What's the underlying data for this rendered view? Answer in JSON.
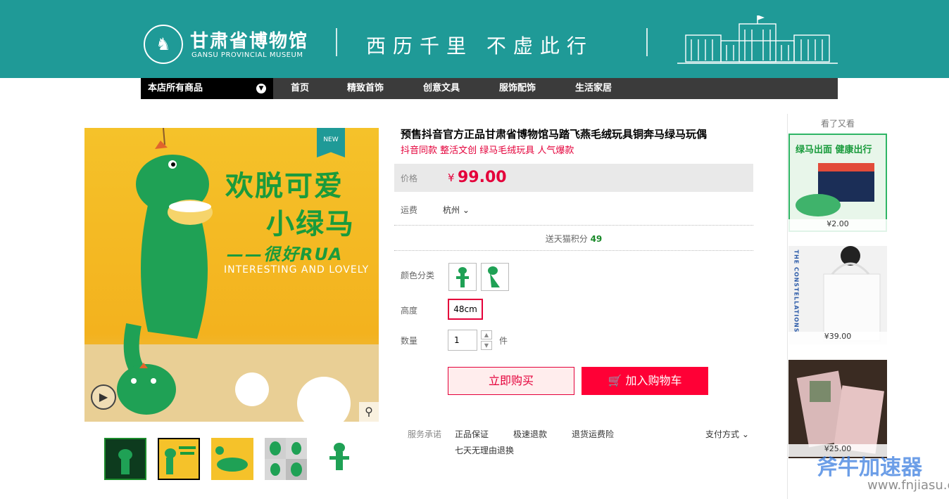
{
  "header": {
    "logo_cn": "甘肃省博物馆",
    "logo_en": "GANSU PROVINCIAL MUSEUM",
    "slogan": "西历千里  不虚此行",
    "colors": {
      "banner": "#1f9a97",
      "nav": "#3b3b3b"
    }
  },
  "nav": {
    "all_products": "本店所有商品",
    "items": [
      "首页",
      "精致首饰",
      "创意文具",
      "服饰配饰",
      "生活家居"
    ]
  },
  "gallery": {
    "badge": "NEW",
    "promo_line1": "欢脱可爱",
    "promo_line2": "小绿马",
    "promo_line3": "——很好RUA",
    "promo_line4": "INTERESTING AND LOVELY",
    "thumb_count": 5
  },
  "product": {
    "title": "预售抖音官方正品甘肃省博物馆马踏飞燕毛绒玩具铜奔马绿马玩偶",
    "subtitle": "抖音同款 整活文创 绿马毛绒玩具 人气爆款",
    "price_label": "价格",
    "price_symbol": "¥",
    "price": "99.00",
    "shipping_label": "运费",
    "shipping_value": "杭州",
    "points_text": "送天猫积分",
    "points_value": "49",
    "color_label": "颜色分类",
    "height_label": "高度",
    "height_option": "48cm",
    "quantity_label": "数量",
    "quantity": "1",
    "unit": "件",
    "buy_now": "立即购买",
    "add_cart": "加入购物车"
  },
  "service": {
    "label": "服务承诺",
    "items": [
      "正品保证",
      "极速退款",
      "退货运费险"
    ],
    "extra": "七天无理由退换",
    "payment": "支付方式"
  },
  "sidebar": {
    "title": "看了又看",
    "cards": [
      {
        "caption": "绿马出面 健康出行",
        "price": "¥2.00"
      },
      {
        "caption": "THE CONSTELLATIONS",
        "price": "¥39.00"
      },
      {
        "caption": "",
        "price": "¥25.00"
      }
    ]
  },
  "watermark": {
    "line1": "斧牛加速器",
    "line2": "www.fnjiasu.com"
  }
}
